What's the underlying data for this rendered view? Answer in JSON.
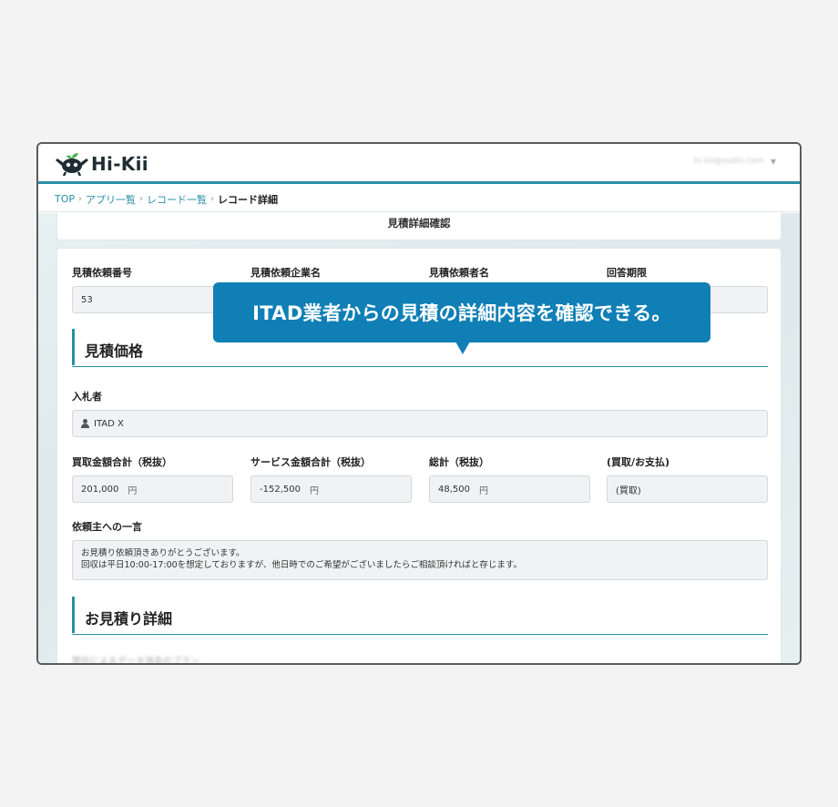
{
  "app": {
    "logo_text": "Hi-Kii",
    "user_email": "hi-kii@sushi.com"
  },
  "breadcrumb": {
    "items": [
      "TOP",
      "アプリ一覧",
      "レコード一覧"
    ],
    "separator": "›",
    "current": "レコード詳細"
  },
  "page": {
    "title": "見積詳細確認"
  },
  "info": {
    "fields": [
      {
        "label": "見積依頼番号",
        "value": "53"
      },
      {
        "label": "見積依頼企業名",
        "value": ""
      },
      {
        "label": "見積依頼者名",
        "value": ""
      },
      {
        "label": "回答期限",
        "value": ""
      }
    ]
  },
  "sections": {
    "price": "見積価格",
    "detail": "お見積り詳細"
  },
  "bidder": {
    "label": "入札者",
    "value": "ITAD X",
    "icon": "person-icon"
  },
  "amounts": [
    {
      "label": "買取金額合計（税抜）",
      "value": "201,000",
      "unit": "円"
    },
    {
      "label": "サービス金額合計（税抜）",
      "value": "-152,500",
      "unit": "円"
    },
    {
      "label": "総計（税抜）",
      "value": "48,500",
      "unit": "円"
    },
    {
      "label": "(買取/お支払)",
      "value": "(買取)",
      "unit": ""
    }
  ],
  "comment": {
    "label": "依頼主への一言",
    "line1": "お見積り依頼頂きありがとうございます。",
    "line2": "回収は平日10:00-17:00を想定しておりますが、他日時でのご希望がございましたらご相談頂ければと存じます。"
  },
  "detail_preview": "弊社によるデータ消去のプラン",
  "callout": {
    "text": "ITAD業者からの見積の詳細内容を確認できる。"
  },
  "colors": {
    "accent": "#2a8fa6",
    "callout": "#0f7fb6",
    "logo_green": "#3bb54a",
    "logo_dark": "#1f2d33"
  }
}
